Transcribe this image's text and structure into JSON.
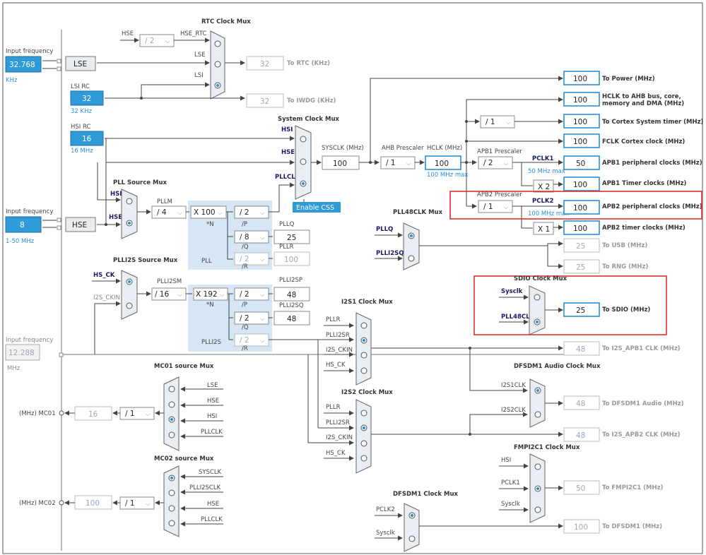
{
  "left_inputs": {
    "lse_freq_label": "Input frequency",
    "lse_freq_value": "32.768",
    "lse_freq_unit": "KHz",
    "lse_button": "LSE",
    "lsi_label": "LSI RC",
    "lsi_value": "32",
    "lsi_unit": "32 KHz",
    "hsi_label": "HSI RC",
    "hsi_value": "16",
    "hsi_unit": "16 MHz",
    "hse_freq_label": "Input frequency",
    "hse_freq_value": "8",
    "hse_range": "1-50 MHz",
    "hse_button": "HSE",
    "i2s_freq_label": "Input frequency",
    "i2s_freq_value": "12.288",
    "i2s_unit": "MHz"
  },
  "rtc": {
    "title": "RTC Clock Mux",
    "hse_label": "HSE",
    "div_value": "/ 2",
    "hse_rtc_label": "HSE_RTC",
    "lse_label": "LSE",
    "lsi_label": "LSI",
    "rtc_value": "32",
    "rtc_label": "To RTC (KHz)",
    "iwdg_value": "32",
    "iwdg_label": "To IWDG (KHz)"
  },
  "sysclk_mux": {
    "title": "System Clock Mux",
    "hsi": "HSI",
    "hse": "HSE",
    "pllclk": "PLLCLK",
    "sysclk_label": "SYSCLK (MHz)",
    "sysclk_value": "100",
    "enable_css": "Enable CSS"
  },
  "ahb": {
    "label": "AHB Prescaler",
    "hclk_label": "HCLK (MHz)",
    "div": "/ 1",
    "hclk_value": "100",
    "hclk_max": "100 MHz max"
  },
  "apb1": {
    "label": "APB1 Prescaler",
    "div": "/ 2",
    "pclk1": "PCLK1",
    "pclk1_max": "50 MHz max",
    "timer_mult": "X 2"
  },
  "apb2": {
    "label": "APB2 Prescaler",
    "div": "/ 1",
    "pclk2": "PCLK2",
    "pclk2_max": "100 MHz max",
    "timer_mult": "X 1"
  },
  "cortex_div": "/ 1",
  "outputs": [
    {
      "value": "100",
      "label": "To Power (MHz)"
    },
    {
      "value": "100",
      "label": "HCLK to AHB bus, core,"
    },
    {
      "value": "100",
      "label": "To Cortex System timer (MHz)"
    },
    {
      "value": "100",
      "label": "FCLK Cortex clock (MHz)"
    },
    {
      "value": "50",
      "label": "APB1 peripheral clocks (MHz)"
    },
    {
      "value": "100",
      "label": "APB1 Timer clocks (MHz)"
    },
    {
      "value": "100",
      "label": "APB2 peripheral clocks (MHz)"
    },
    {
      "value": "100",
      "label": "APB2 timer clocks (MHz)"
    },
    {
      "value": "25",
      "label": "To USB (MHz)"
    },
    {
      "value": "25",
      "label": "To RNG (MHz)"
    }
  ],
  "hclk_label_line2": "memory and DMA (MHz)",
  "pll": {
    "src_title": "PLL Source Mux",
    "hsi": "HSI",
    "hse": "HSE",
    "pllm_label": "PLLM",
    "pllm_value": "/ 4",
    "n_value": "X 100",
    "n_label": "*N",
    "p_value": "/ 2",
    "p_label": "/P",
    "q_value": "/ 8",
    "q_label": "/Q",
    "r_value": "/ 2",
    "r_label": "/R",
    "pllq_label": "PLLQ",
    "pllq_value": "25",
    "pllr_label": "PLLR",
    "pllr_value": "100",
    "pll_label": "PLL"
  },
  "pll48": {
    "title": "PLL48CLK Mux",
    "pllq": "PLLQ",
    "plli2sq": "PLLI2SQ"
  },
  "sdio": {
    "title": "SDIO Clock Mux",
    "sysclk": "Sysclk",
    "pll48clk": "PLL48CLK",
    "value": "25",
    "label": "To SDIO (MHz)"
  },
  "plli2s": {
    "src_title": "PLLI2S Source Mux",
    "hs_ck": "HS_CK",
    "i2s_ckin": "I2S_CKIN",
    "m_label": "PLLI2SM",
    "m_value": "/ 16",
    "n_value": "X 192",
    "n_label": "*N",
    "p_value": "/ 2",
    "p_label": "/P",
    "q_value": "/ 2",
    "q_label": "/Q",
    "r_value": "/ 2",
    "r_label": "/R",
    "sp_label": "PLLI2SP",
    "sp_value": "48",
    "sq_label": "PLLI2SQ",
    "sq_value": "48",
    "name": "PLLI2S"
  },
  "i2s1": {
    "title": "I2S1 Clock Mux",
    "inputs": [
      "PLLR",
      "PLLI2SR",
      "I2S_CKIN",
      "HS_CK"
    ],
    "value": "48",
    "label": "To I2S_APB1 CLK (MHz)"
  },
  "i2s2": {
    "title": "I2S2 Clock Mux",
    "inputs": [
      "PLLR",
      "PLLI2SR",
      "I2S_CKIN",
      "HS_CK"
    ],
    "value": "48",
    "label": "To I2S_APB2 CLK (MHz)"
  },
  "dfsdm_audio": {
    "title": "DFSDM1 Audio Clock Mux",
    "in1": "I2S1CLK",
    "in2": "I2S2CLK",
    "value": "48",
    "label": "To DFSDM1 Audio (MHz)"
  },
  "fmpi2c": {
    "title": "FMPI2C1 Clock Mux",
    "inputs": [
      "HSI",
      "PCLK1",
      "Sysclk"
    ],
    "value": "50",
    "label": "To FMPI2C1 (MHz)"
  },
  "dfsdm1": {
    "title": "DFSDM1 Clock Mux",
    "in1": "PCLK2",
    "in2": "Sysclk",
    "value": "100",
    "label": "To DFSDM1 (MHz)"
  },
  "mco1": {
    "title": "MC01 source Mux",
    "inputs": [
      "LSE",
      "HSE",
      "HSI",
      "PLLCLK"
    ],
    "div": "/ 1",
    "value": "16",
    "label": "(MHz) MC01"
  },
  "mco2": {
    "title": "MC02 source Mux",
    "inputs": [
      "SYSCLK",
      "PLLI2SCLK",
      "HSE",
      "PLLCLK"
    ],
    "div": "/ 1",
    "value": "100",
    "label": "(MHz) MC02"
  }
}
